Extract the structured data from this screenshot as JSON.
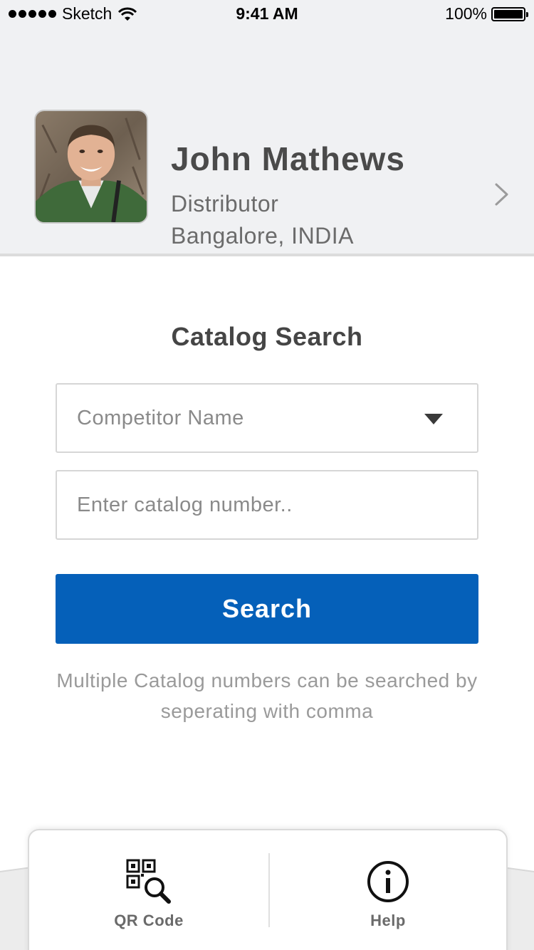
{
  "status_bar": {
    "carrier": "Sketch",
    "time": "9:41 AM",
    "battery": "100%",
    "battery_level": 1.0
  },
  "profile": {
    "name": "John Mathews",
    "role": "Distributor",
    "location": "Bangalore, INDIA"
  },
  "catalog_search": {
    "title": "Catalog Search",
    "competitor_placeholder": "Competitor Name",
    "catalog_placeholder": "Enter catalog number..",
    "search_label": "Search",
    "hint": "Multiple Catalog numbers can be searched by seperating with comma"
  },
  "tab_bar": {
    "items": [
      {
        "label": "QR Code",
        "icon": "qr-search-icon"
      },
      {
        "label": "Help",
        "icon": "info-icon"
      }
    ]
  },
  "colors": {
    "primary": "#0560b9",
    "header_bg": "#f0f1f3",
    "text_dark": "#4a4a4a",
    "text_muted": "#8a8a8a"
  }
}
